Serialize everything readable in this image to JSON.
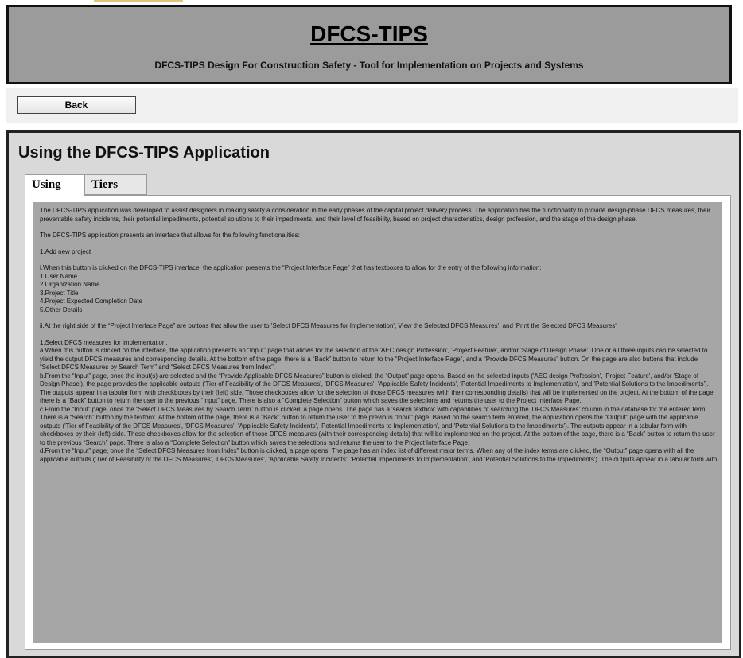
{
  "header": {
    "title": "DFCS-TIPS",
    "subtitle": "DFCS-TIPS Design For Construction Safety - Tool for Implementation on Projects and Systems"
  },
  "toolbar": {
    "back_label": "Back"
  },
  "main": {
    "title": "Using the DFCS-TIPS Application",
    "tabs": [
      {
        "label": "Using"
      },
      {
        "label": "Tiers"
      }
    ],
    "paragraphs": [
      "The DFCS-TIPS application was developed to assist designers in making safety a consideration in the early phases of the capital project delivery process. The application has the functionality to provide design-phase DFCS measures, their preventable safety incidents, their potential impediments, potential solutions to their impediments, and their level of feasibility, based on project characteristics, design profession, and the stage of the design phase.",
      "The DFCS-TIPS application presents an interface that allows for the following functionalities:",
      "1.Add new project",
      "i.When this button is clicked on the DFCS-TIPS interface, the application presents the “Project Interface Page” that has textboxes to allow for the entry of the following information:\n1.User Name\n2.Organization Name\n3.Project Title\n4.Project Expected Completion Date\n5.Other Details",
      "ii.At the right side of the “Project Interface Page” are buttons that allow the user to 'Select DFCS Measures for Implementation', View the Selected DFCS Measures', and 'Print the Selected DFCS Measures'",
      "1.Select DFCS measures for implementation.\na.When this button is clicked on the interface, the application presents an “Input” page that allows for the selection of the 'AEC design Profession', 'Project Feature', and/or 'Stage of Design Phase'. One or all three inputs can be selected to yield the output DFCS measures and corresponding details. At the bottom of the page, there is a “Back” button to return to the “Project Interface Page”, and a “Provide DFCS Measures” button. On the page are also buttons that include “Select DFCS Measures by Search Term” and “Select DFCS Measures from Index”.\nb.From the “Input” page, once the input(s) are selected and the “Provide Applicable DFCS Measures” button is clicked, the “Output” page opens. Based on the selected inputs ('AEC design Profession', 'Project Feature', and/or 'Stage of Design Phase'), the page provides the applicable outputs ('Tier of Feasibility of the DFCS Measures', 'DFCS Measures', 'Applicable Safety Incidents', 'Potential Impediments to Implementation', and 'Potential Solutions to the Impediments'). The outputs appear in a tabular form with checkboxes by their (left) side. Those checkboxes allow for the selection of those DFCS measures (with their corresponding details) that will be implemented on the project. At the bottom of the page, there is a “Back” button to return the user to the previous “Input” page. There is also a “Complete Selection” button which saves the selections and returns the user to the Project Interface Page.\nc.From the “Input” page, once the “Select DFCS Measures by Search Term” button is clicked, a page opens. The page has a 'search textbox' with capabilities of searching the 'DFCS Measures' column in the database for the entered term. There is a “Search” button by the textbox. At the bottom of the page, there is a “Back” button to return the user to the previous “Input” page. Based on the search term entered, the application opens the “Output” page with the applicable outputs ('Tier of Feasibility of the DFCS Measures', 'DFCS Measures', 'Applicable Safety Incidents', 'Potential Impediments to Implementation', and 'Potential Solutions to the Impediments'). The outputs appear in a tabular form with checkboxes by their (left) side. These checkboxes allow for the selection of those DFCS measures (with their corresponding details) that will be implemented on the project. At the bottom of the page, there is a “Back” button to return the user to the previous “Search” page. There is also a “Complete Selection” button which saves the selections and returns the user to the Project Interface Page.\nd.From the “Input” page, once the “Select DFCS Measures from Index” button is clicked, a page opens. The page has an index list of different major terms. When any of the index terms are clicked, the “Output” page opens with all the applicable outputs ('Tier of Feasibility of the DFCS Measures', 'DFCS Measures', 'Applicable Safety Incidents', 'Potential Impediments to Implementation', and 'Potential Solutions to the Impediments'). The outputs appear in a tabular form with"
    ]
  }
}
